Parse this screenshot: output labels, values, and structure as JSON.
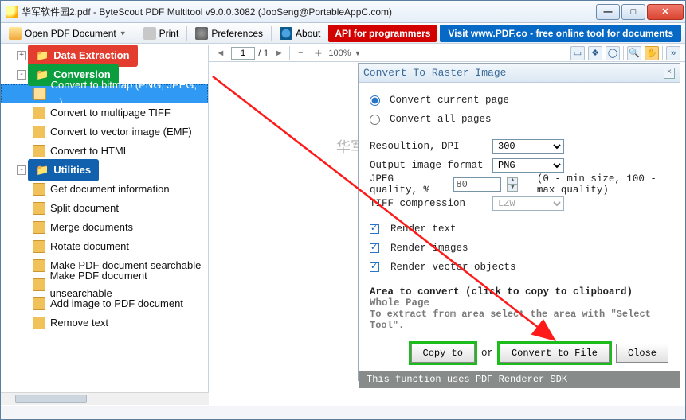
{
  "title": "华军软件园2.pdf - ByteScout PDF Multitool v9.0.0.3082 (JooSeng@PortableAppC.com)",
  "toolbar": {
    "open": "Open PDF Document",
    "print": "Print",
    "pref": "Preferences",
    "about": "About",
    "api": "API for programmers",
    "pdfco": "Visit www.PDF.co - free online tool for documents"
  },
  "tree": {
    "groups": [
      {
        "label": "Data Extraction",
        "color": "red",
        "expand": "+"
      },
      {
        "label": "Conversion",
        "color": "green",
        "expand": "-",
        "children": [
          {
            "label": "Convert to bitmap (PNG, JPEG, ...)",
            "sel": true
          },
          {
            "label": "Convert to multipage TIFF"
          },
          {
            "label": "Convert to vector image (EMF)"
          },
          {
            "label": "Convert to HTML"
          }
        ]
      },
      {
        "label": "Utilities",
        "color": "blue",
        "expand": "-",
        "children": [
          {
            "label": "Get document information"
          },
          {
            "label": "Split document"
          },
          {
            "label": "Merge documents"
          },
          {
            "label": "Rotate document"
          },
          {
            "label": "Make PDF document searchable"
          },
          {
            "label": "Make PDF document unsearchable"
          },
          {
            "label": "Add image to PDF document"
          },
          {
            "label": "Remove text"
          }
        ]
      }
    ]
  },
  "nav": {
    "page": "1",
    "pages": "/ 1",
    "zoom": "100%"
  },
  "watermark": "华军软件园",
  "panel": {
    "title": "Convert To Raster Image",
    "opt_current": "Convert current page",
    "opt_all": "Convert all pages",
    "lbl_res": "Resoultion, DPI",
    "val_res": "300",
    "lbl_fmt": "Output image format",
    "val_fmt": "PNG",
    "lbl_q": "JPEG quality, %",
    "val_q": "80",
    "hint_q": "(0 - min size, 100 - max quality)",
    "lbl_tiff": "TIFF compression",
    "val_tiff": "LZW",
    "cb_text": "Render text",
    "cb_img": "Render images",
    "cb_vec": "Render vector objects",
    "area_hdr": "Area to convert (click to copy to clipboard)",
    "area_whole": "Whole Page",
    "area_sub": "To extract from area select the area with \"Select Tool\".",
    "btn_copy": "Copy to",
    "or": "or",
    "btn_conv": "Convert to File",
    "btn_close": "Close",
    "footer": "This function uses PDF Renderer SDK"
  }
}
